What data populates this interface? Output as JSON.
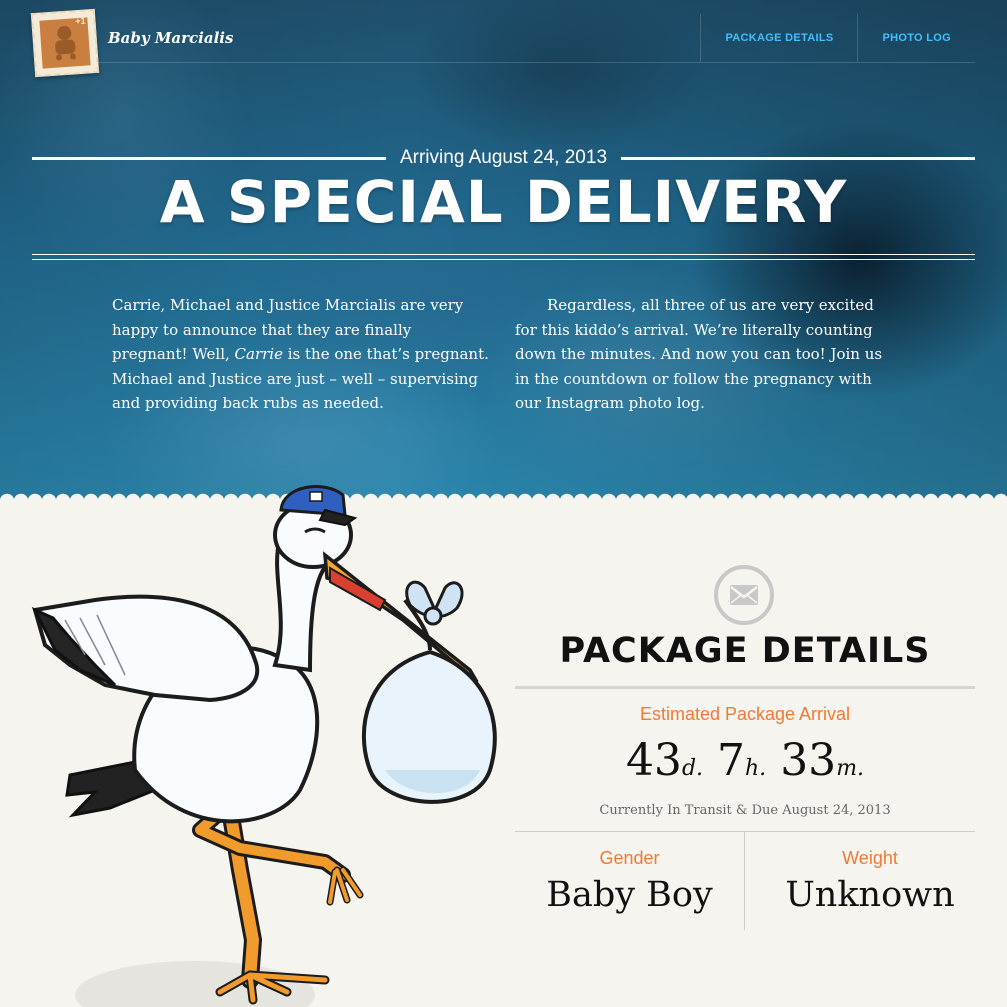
{
  "header": {
    "brand": "Baby Marcialis",
    "stamp_badge": "+1",
    "nav": [
      {
        "label": "PACKAGE DETAILS"
      },
      {
        "label": "PHOTO LOG"
      }
    ]
  },
  "hero": {
    "arriving": "Arriving August 24, 2013",
    "headline": "A SPECIAL DELIVERY",
    "intro_col1": {
      "part1": "Carrie, Michael and Justice Marcialis are very happy to announce that they are finally pregnant! Well, ",
      "emph": "Carrie",
      "part2": " is the one that’s pregnant. Michael and Justice are just – well – supervising and providing back rubs as needed."
    },
    "intro_col2": "Regardless, all three of us are very excited for this kiddo’s arrival. We’re literally counting down the minutes. And now you can too! Join us in the countdown or follow the pregnancy with our Instagram photo log."
  },
  "package": {
    "title": "PACKAGE DETAILS",
    "estimated_label": "Estimated Package Arrival",
    "countdown": {
      "days": "43",
      "days_unit": "d.",
      "hours": "7",
      "hours_unit": "h.",
      "minutes": "33",
      "minutes_unit": "m."
    },
    "due_text": "Currently In Transit & Due August 24, 2013",
    "gender_label": "Gender",
    "gender_value": "Baby Boy",
    "weight_label": "Weight",
    "weight_value": "Unknown"
  },
  "icons": {
    "logo": "baby-stamp-icon",
    "envelope": "envelope-icon",
    "illustration": "stork-illustration"
  },
  "colors": {
    "accent_orange": "#ee7a35",
    "nav_link": "#3fc0ff",
    "hero_blue": "#216a90",
    "paper": "#f6f4ef"
  }
}
